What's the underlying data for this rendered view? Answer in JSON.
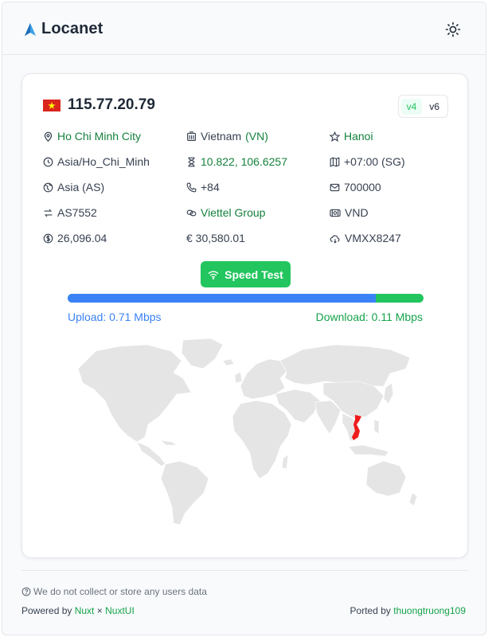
{
  "app": {
    "title": "Locanet",
    "theme_toggle": "sun-icon"
  },
  "ip": {
    "flag": "vn-flag",
    "address": "115.77.20.79",
    "versions": [
      "v4",
      "v6"
    ],
    "active_version": "v4"
  },
  "details": {
    "city": "Ho Chi Minh City",
    "country": "Vietnam",
    "country_code": "(VN)",
    "capital": "Hanoi",
    "timezone": "Asia/Ho_Chi_Minh",
    "coordinates": "10.822, 106.6257",
    "utc_offset": "+07:00 (SG)",
    "continent": "Asia (AS)",
    "calling_code": "+84",
    "postal_code": "700000",
    "asn": "AS7552",
    "org": "Viettel Group",
    "currency": "VND",
    "usd_rate": "26,096.04",
    "eur_rate": "€ 30,580.01",
    "weather_code": "VMXX8247"
  },
  "speed": {
    "button_label": "Speed Test",
    "upload_label": "Upload: 0.71 Mbps",
    "download_label": "Download: 0.11 Mbps",
    "upload_fraction": 0.865,
    "upload_color": "#3b82f6",
    "download_color": "#22c55e"
  },
  "map": {
    "highlight_country": "Vietnam",
    "land_color": "#e5e5e5",
    "highlight_color": "#ef1c1c"
  },
  "footer": {
    "privacy": "We do not collect or store any users data",
    "powered_prefix": "Powered by",
    "nuxt": "Nuxt",
    "times": "×",
    "nuxtui": "NuxtUI",
    "ported_prefix": "Ported by",
    "author": "thuongtruong109"
  }
}
